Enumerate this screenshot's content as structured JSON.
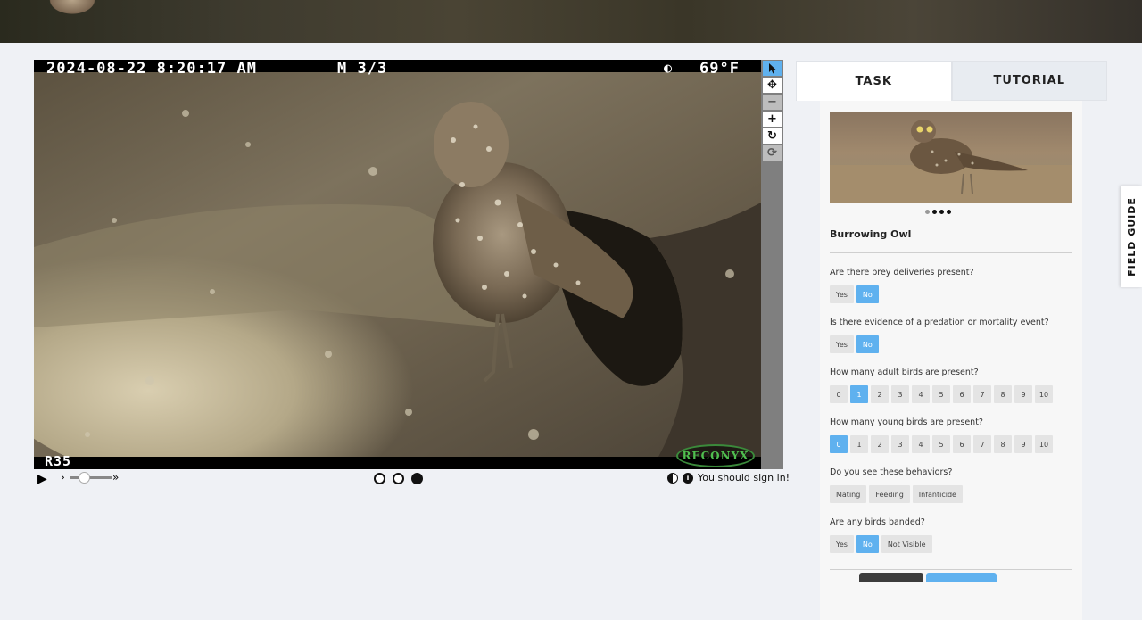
{
  "viewer": {
    "timestamp": "2024-08-22 8:20:17 AM",
    "frame": "M 3/3",
    "moon_icon": "half-moon-icon",
    "temperature": "69°F",
    "camera_id": "R35",
    "brand": "RECONYX"
  },
  "toolbar": {
    "tools": [
      "pointer-icon",
      "move-icon",
      "zoom-out-icon",
      "zoom-in-icon",
      "rotate-icon",
      "reset-icon"
    ]
  },
  "controls": {
    "play_icon": "▶",
    "signin_text": "You should sign in!"
  },
  "tabs": {
    "task": "TASK",
    "tutorial": "TUTORIAL"
  },
  "task": {
    "species": "Burrowing Owl",
    "questions": [
      {
        "text": "Are there prey deliveries present?",
        "options": [
          "Yes",
          "No"
        ],
        "selected": "No"
      },
      {
        "text": "Is there evidence of a predation or mortality event?",
        "options": [
          "Yes",
          "No"
        ],
        "selected": "No"
      },
      {
        "text": "How many adult birds are present?",
        "options": [
          "0",
          "1",
          "2",
          "3",
          "4",
          "5",
          "6",
          "7",
          "8",
          "9",
          "10"
        ],
        "selected": "1"
      },
      {
        "text": "How many young birds are present?",
        "options": [
          "0",
          "1",
          "2",
          "3",
          "4",
          "5",
          "6",
          "7",
          "8",
          "9",
          "10"
        ],
        "selected": "0"
      },
      {
        "text": "Do you see these behaviors?",
        "options": [
          "Mating",
          "Feeding",
          "Infanticide"
        ],
        "selected": ""
      },
      {
        "text": "Are any birds banded?",
        "options": [
          "Yes",
          "No",
          "Not Visible"
        ],
        "selected": "No"
      }
    ]
  },
  "field_guide": {
    "label": "FIELD GUIDE"
  },
  "colors": {
    "accent": "#5fb1ef",
    "page_bg": "#eff1f5",
    "button_bg": "#e4e4e4"
  }
}
